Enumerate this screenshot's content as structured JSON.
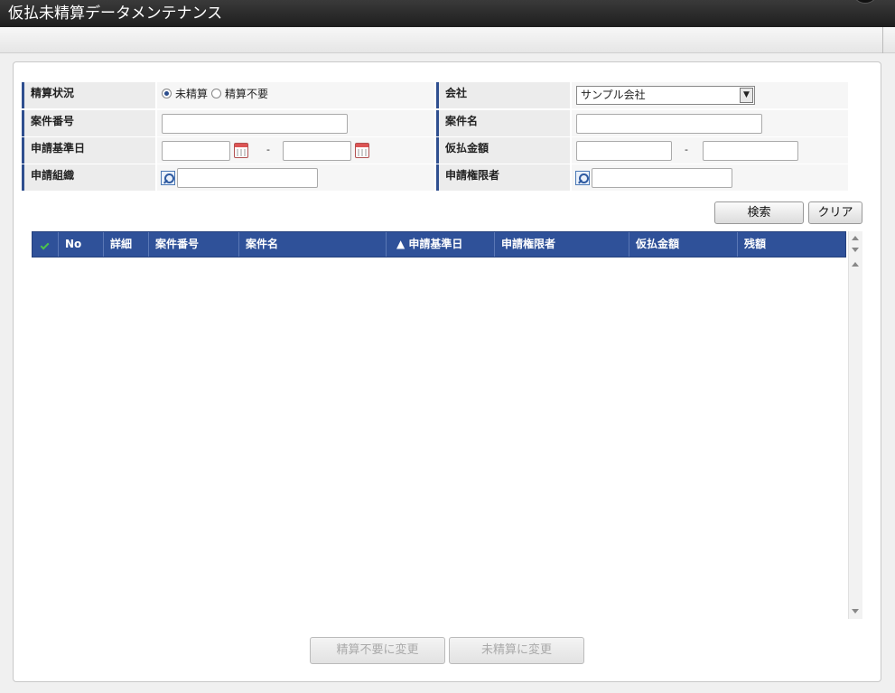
{
  "window": {
    "title": "仮払未精算データメンテナンス"
  },
  "form": {
    "settlement_status": {
      "label": "精算状況",
      "options": [
        "未精算",
        "精算不要"
      ],
      "selected": "未精算"
    },
    "company": {
      "label": "会社",
      "value": "サンプル会社"
    },
    "case_number": {
      "label": "案件番号",
      "value": ""
    },
    "case_name": {
      "label": "案件名",
      "value": ""
    },
    "application_date": {
      "label": "申請基準日",
      "from": "",
      "to": "",
      "separator": "-"
    },
    "advance_amount": {
      "label": "仮払金額",
      "from": "",
      "to": "",
      "separator": "-"
    },
    "application_org": {
      "label": "申請組織",
      "value": ""
    },
    "application_authority": {
      "label": "申請権限者",
      "value": ""
    }
  },
  "actions": {
    "search": "検索",
    "clear": "クリア"
  },
  "grid": {
    "columns": [
      "No",
      "詳細",
      "案件番号",
      "案件名",
      "▲ 申請基準日",
      "申請権限者",
      "仮払金額",
      "残額"
    ],
    "rows": []
  },
  "footer": {
    "mark_not_needed": "精算不要に変更",
    "mark_unsettled": "未精算に変更"
  },
  "colors": {
    "header_blue": "#2f5199",
    "label_accent": "#2f4f8f"
  },
  "icons": {
    "date_picker": "calendar-icon",
    "lookup": "search-icon",
    "select_all": "check-icon"
  }
}
